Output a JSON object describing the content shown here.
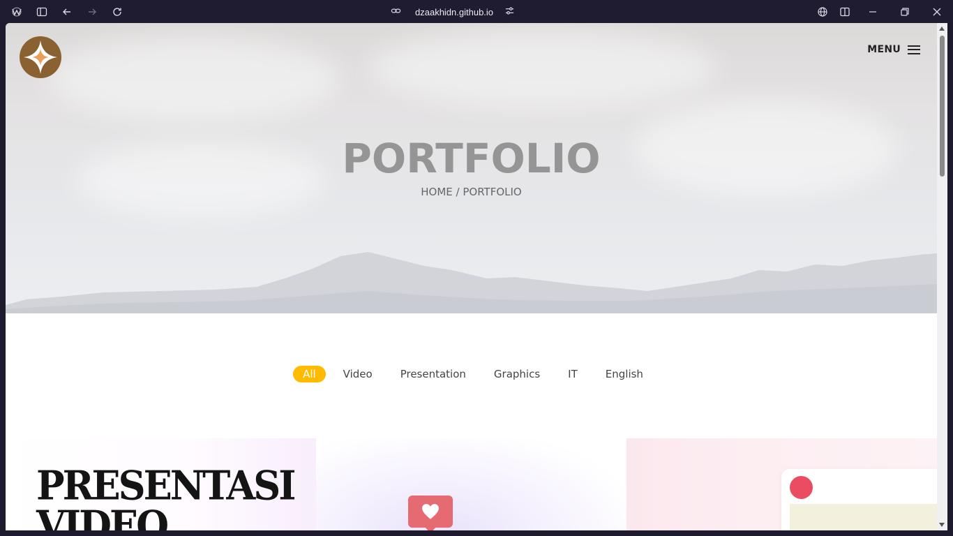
{
  "browser": {
    "url": "dzaakhidn.github.io",
    "icons": [
      "app-logo-icon",
      "sidebar-toggle-icon",
      "back-icon",
      "forward-icon",
      "reload-icon",
      "link-icon",
      "site-settings-icon",
      "translate-icon",
      "split-view-icon",
      "minimize-icon",
      "restore-icon",
      "close-icon"
    ]
  },
  "header": {
    "menu_label": "MENU"
  },
  "hero": {
    "title": "PORTFOLIO",
    "breadcrumb": "HOME / PORTFOLIO"
  },
  "filters": {
    "items": [
      "All",
      "Video",
      "Presentation",
      "Graphics",
      "IT",
      "English"
    ],
    "active": "All"
  },
  "cards": {
    "card1_title": "PRESENTASI VIDEO"
  },
  "colors": {
    "accent": "#ffbb00",
    "logo_brown": "#8a6232",
    "logo_star": "#e8a05a",
    "heart_bubble": "#e66a72",
    "dot_red": "#ec4c62"
  }
}
